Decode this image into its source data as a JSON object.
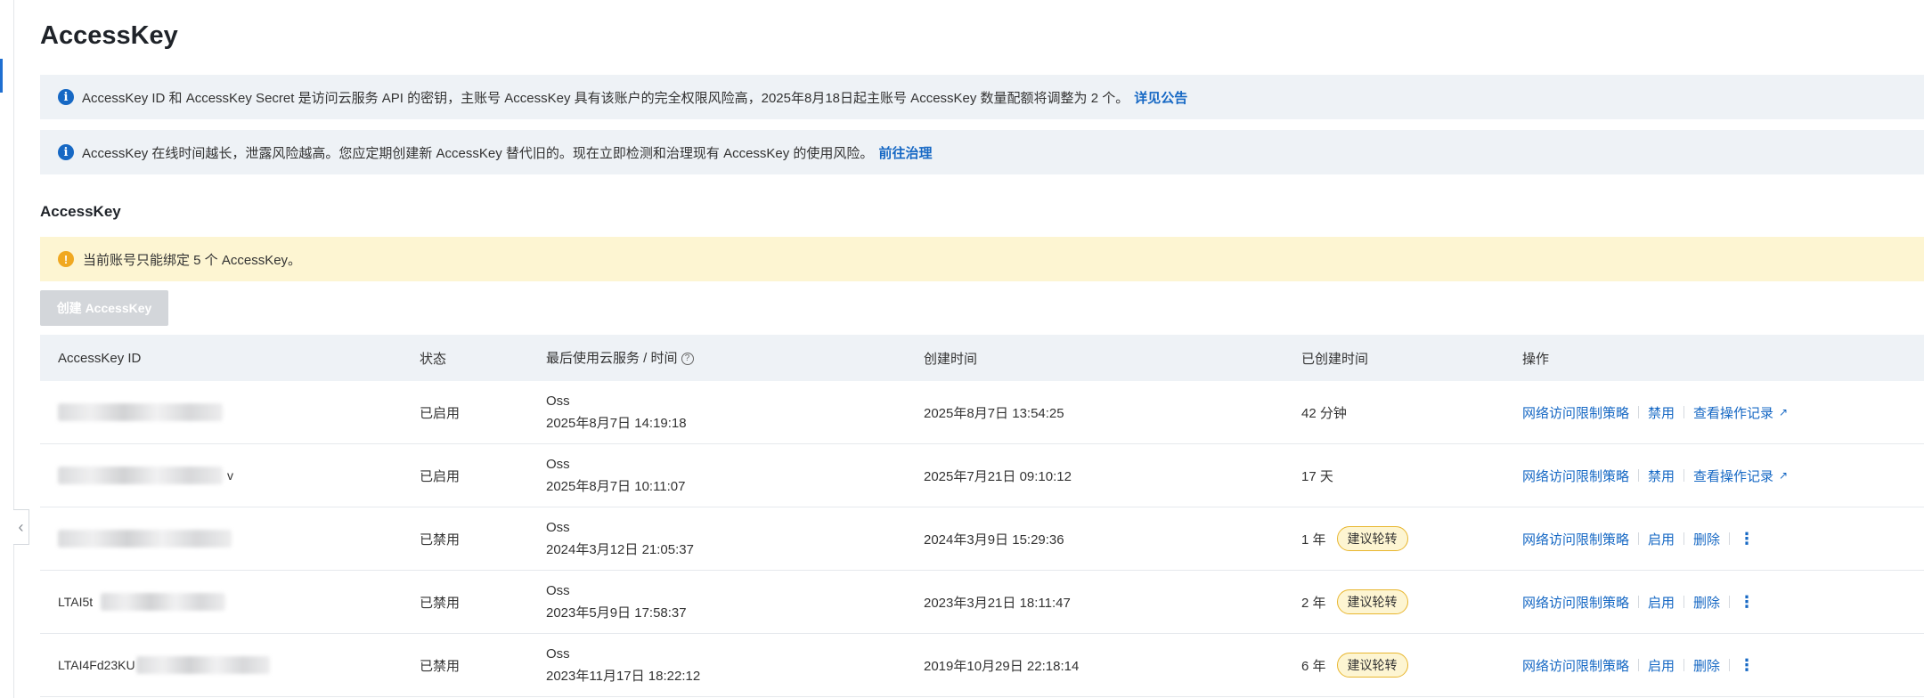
{
  "page": {
    "title": "AccessKey"
  },
  "banners": [
    {
      "text": "AccessKey ID 和 AccessKey Secret 是访问云服务 API 的密钥，主账号 AccessKey 具有该账户的完全权限风险高，2025年8月18日起主账号 AccessKey 数量配额将调整为 2 个。",
      "link": "详见公告"
    },
    {
      "text": "AccessKey 在线时间越长，泄露风险越高。您应定期创建新 AccessKey 替代旧的。现在立即检测和治理现有 AccessKey 的使用风险。",
      "link": "前往治理"
    }
  ],
  "section": {
    "title": "AccessKey"
  },
  "warning": {
    "text": "当前账号只能绑定 5 个 AccessKey。"
  },
  "create_button": {
    "label": "创建 AccessKey"
  },
  "table": {
    "headers": [
      "AccessKey ID",
      "状态",
      "最后使用云服务 / 时间",
      "创建时间",
      "已创建时间",
      "操作"
    ],
    "rows": [
      {
        "ak_prefix": "",
        "ak_suffix": "",
        "status": "已启用",
        "service": "Oss",
        "last_used": "2025年8月7日 14:19:18",
        "created": "2025年8月7日 13:54:25",
        "age": "42 分钟",
        "badge": "",
        "ops": [
          "网络访问限制策略",
          "禁用",
          "查看操作记录"
        ]
      },
      {
        "ak_prefix": "",
        "ak_suffix": "v",
        "status": "已启用",
        "service": "Oss",
        "last_used": "2025年8月7日 10:11:07",
        "created": "2025年7月21日 09:10:12",
        "age": "17 天",
        "badge": "",
        "ops": [
          "网络访问限制策略",
          "禁用",
          "查看操作记录"
        ]
      },
      {
        "ak_prefix": "",
        "ak_suffix": "",
        "status": "已禁用",
        "service": "Oss",
        "last_used": "2024年3月12日 21:05:37",
        "created": "2024年3月9日 15:29:36",
        "age": "1 年",
        "badge": "建议轮转",
        "ops": [
          "网络访问限制策略",
          "启用",
          "删除"
        ]
      },
      {
        "ak_prefix": "LTAI5t",
        "ak_suffix": "",
        "status": "已禁用",
        "service": "Oss",
        "last_used": "2023年5月9日 17:58:37",
        "created": "2023年3月21日 18:11:47",
        "age": "2 年",
        "badge": "建议轮转",
        "ops": [
          "网络访问限制策略",
          "启用",
          "删除"
        ]
      },
      {
        "ak_prefix": "LTAI4Fd23KU",
        "ak_suffix": "",
        "status": "已禁用",
        "service": "Oss",
        "last_used": "2023年11月17日 18:22:12",
        "created": "2019年10月29日 22:18:14",
        "age": "6 年",
        "badge": "建议轮转",
        "ops": [
          "网络访问限制策略",
          "启用",
          "删除"
        ]
      }
    ]
  },
  "icons": {
    "info": "info-icon",
    "warning": "warning-icon",
    "help": "question-circle-icon",
    "external": "external-link-icon",
    "more": "more-vertical-icon",
    "collapse": "chevron-left-icon"
  },
  "colors": {
    "link": "#1668c4",
    "info_bg": "#eef2f6",
    "warn_bg": "#fdf5d2",
    "badge_border": "#e8b62f"
  }
}
